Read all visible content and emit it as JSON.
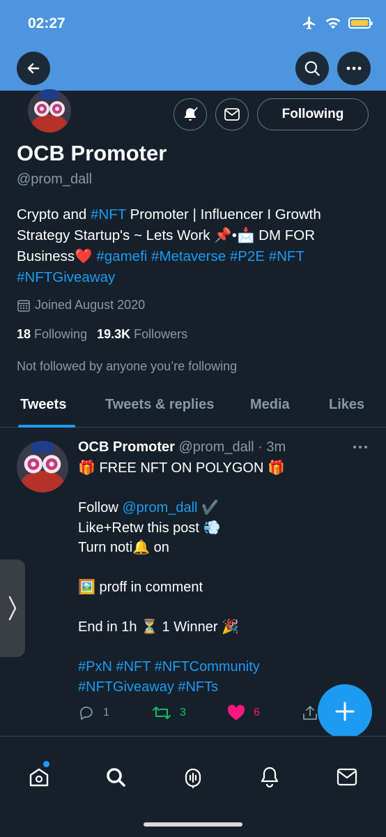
{
  "status_bar": {
    "time": "02:27"
  },
  "profile": {
    "name": "OCB Promoter",
    "handle": "@prom_dall",
    "follow_button": "Following",
    "bio": {
      "t1": "Crypto and ",
      "tag_nft": "#NFT",
      "t2": " Promoter | Influencer I Growth Strategy Startup's ~ Lets Work 📌•📩 DM FOR Business❤️ ",
      "tag_gamefi": "#gamefi",
      "tag_metaverse": "#Metaverse",
      "tag_p2e": "#P2E",
      "tag_nft2": "#NFT",
      "tag_nftgiveaway": "#NFTGiveaway"
    },
    "joined": "Joined August 2020",
    "following_count": "18",
    "following_label": "Following",
    "followers_count": "19.3K",
    "followers_label": "Followers",
    "not_followed": "Not followed by anyone you’re following"
  },
  "tabs": [
    "Tweets",
    "Tweets & replies",
    "Media",
    "Likes"
  ],
  "tweet": {
    "author": "OCB Promoter",
    "handle_time": "@prom_dall · 3m",
    "line1": "🎁 FREE NFT ON POLYGON 🎁",
    "follow_prefix": "Follow ",
    "follow_mention": "@prom_dall",
    "follow_suffix": " ✔️",
    "line3": "Like+Retw this post 💨",
    "line4": "Turn noti🔔 on",
    "line5": "🖼️ proff in comment",
    "line6": "End in 1h ⏳ 1 Winner 🎉",
    "hashtags_line1": "#PxN #NFT #NFTCommunity",
    "hashtags_line2": "#NFTGiveaway #NFTs",
    "replies": "1",
    "retweets": "3",
    "likes": "6"
  },
  "colors": {
    "background": "#15202b",
    "header": "#4d95de",
    "accent": "#1d9bf0",
    "retweet": "#17bf63",
    "like": "#f91880"
  },
  "icons": [
    "back-arrow-icon",
    "search-icon",
    "more-icon",
    "bell-icon",
    "mail-icon",
    "calendar-icon",
    "reply-icon",
    "retweet-icon",
    "heart-icon",
    "share-icon",
    "plus-icon",
    "home-icon",
    "spaces-icon"
  ]
}
